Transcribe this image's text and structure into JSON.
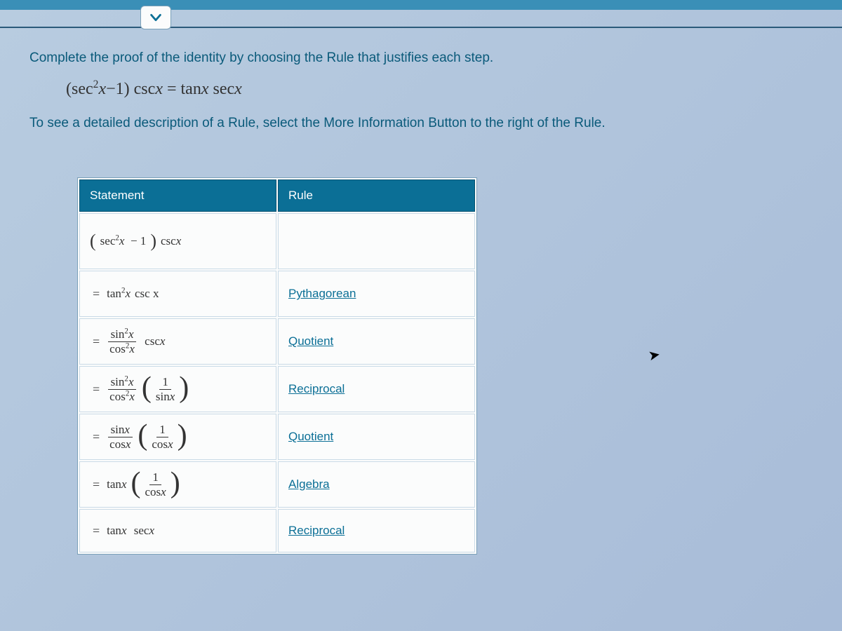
{
  "prompt": {
    "line1": "Complete the proof of the identity by choosing the Rule that justifies each step.",
    "line2": "To see a detailed description of a Rule, select the More Information Button to the right of the Rule."
  },
  "identity": {
    "lhs_open": "(",
    "lhs_fn": "sec",
    "lhs_exp": "2",
    "lhs_var": "x",
    "lhs_minus": "−1",
    "lhs_close": ")",
    "lhs_tail": " csc",
    "lhs_tailx": "x",
    "equals": "= tan",
    "rhs_x": "x",
    "rhs_sec": " sec",
    "rhs_secx": "x"
  },
  "table": {
    "head_statement": "Statement",
    "head_rule": "Rule"
  },
  "rows": [
    {
      "rule": ""
    },
    {
      "rule": "Pythagorean"
    },
    {
      "rule": "Quotient"
    },
    {
      "rule": "Reciprocal"
    },
    {
      "rule": "Quotient"
    },
    {
      "rule": "Algebra"
    },
    {
      "rule": "Reciprocal"
    }
  ],
  "tokens": {
    "eq": "=",
    "sec": "sec",
    "csc": "csc",
    "tan": "tan",
    "sin": "sin",
    "cos": "cos",
    "x": "x",
    "one": "1",
    "two": "2",
    "minus": "−",
    "space_cscx": "csc x",
    "tan2x_cscx": " csc x",
    "sinx": "sin x",
    "cosx": "cos x",
    "tanx": "tan x",
    "secx": "sec x"
  }
}
